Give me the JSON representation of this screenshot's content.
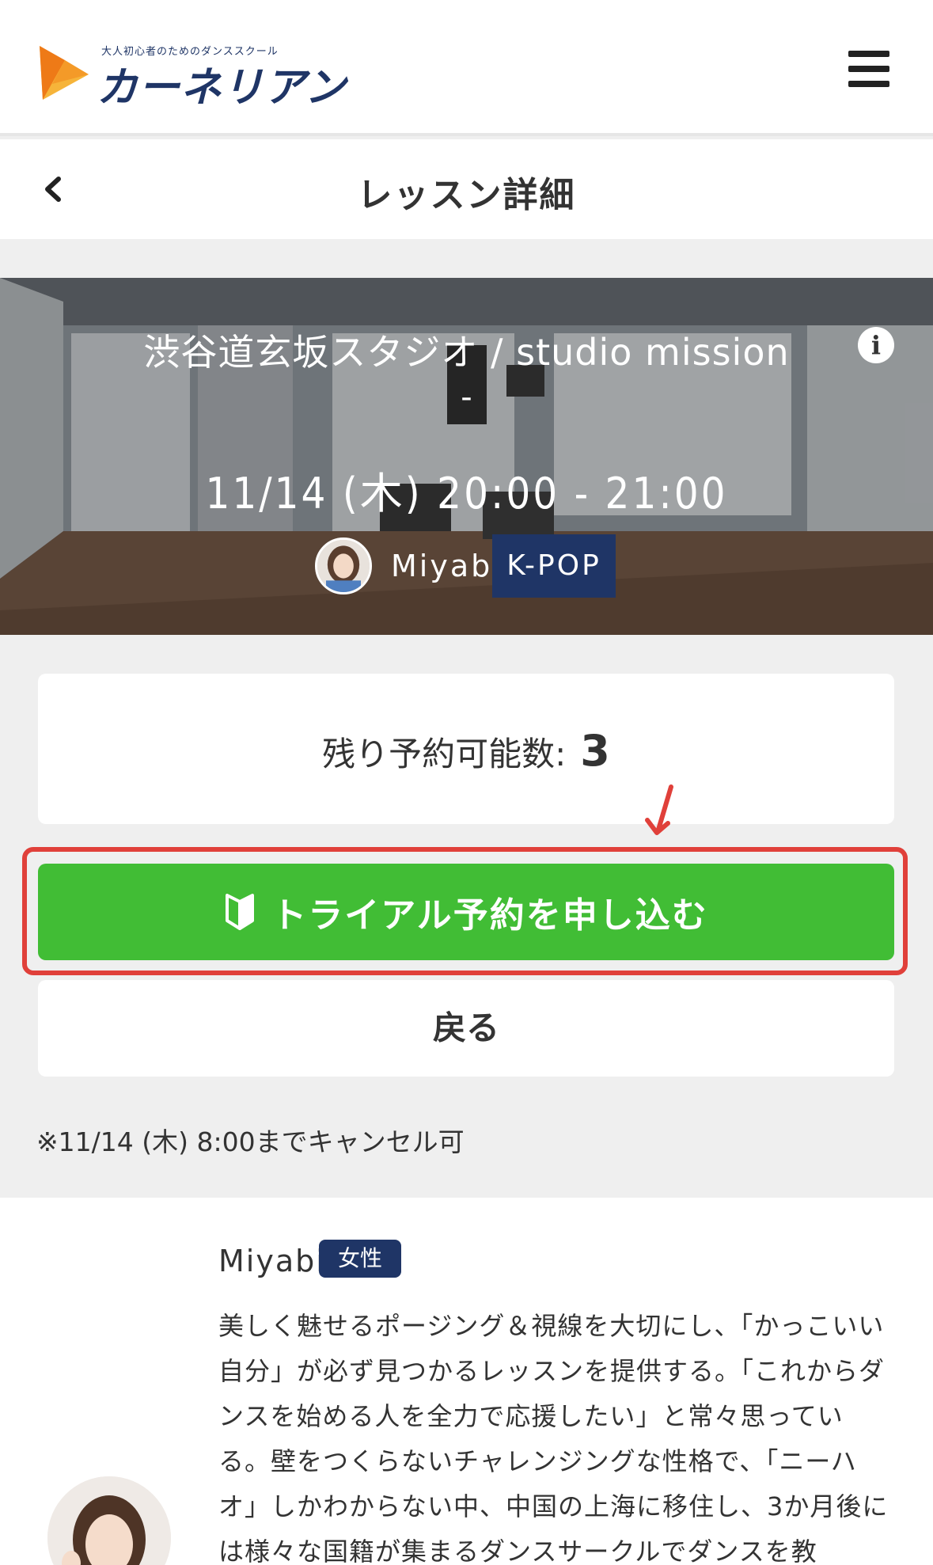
{
  "header": {
    "logo_tagline": "大人初心者のためのダンススクール",
    "logo_text": "カーネリアン",
    "logo_colors": [
      "#f6b43a",
      "#ee7a17"
    ],
    "menu_icon": "hamburger-menu-icon"
  },
  "title_bar": {
    "back_icon": "chevron-left-icon",
    "title": "レッスン詳細"
  },
  "lesson": {
    "studio": "渋谷道玄坂スタジオ / studio mission",
    "studio_sub": "-",
    "datetime": "11/14 (木) 20:00 - 21:00",
    "instructor": "Miyabi",
    "genre": "K-POP",
    "info_icon_glyph": "i"
  },
  "availability": {
    "label": "残り予約可能数:",
    "count": "3"
  },
  "actions": {
    "trial_label": "トライアル予約を申し込む",
    "trial_icon": "beginner-leaf-icon",
    "back_label": "戻る",
    "highlight_color": "#e0403a"
  },
  "cancel_note": "※11/14 (木) 8:00までキャンセル可",
  "instructor_profile": {
    "name": "Miyabi",
    "gender": "女性",
    "bio": "美しく魅せるポージング＆視線を大切にし、「かっこいい自分」が必ず見つかるレッスンを提供する。「これからダンスを始める人を全力で応援したい」と常々思っている。壁をつくらないチャレンジングな性格で、「ニーハオ」しかわからない中、中国の上海に移住し、3か月後には様々な国籍が集まるダンスサークルでダンスを教"
  },
  "colors": {
    "brand_navy": "#1f3566",
    "trial_green": "#41bd35",
    "page_bg": "#efefef"
  }
}
